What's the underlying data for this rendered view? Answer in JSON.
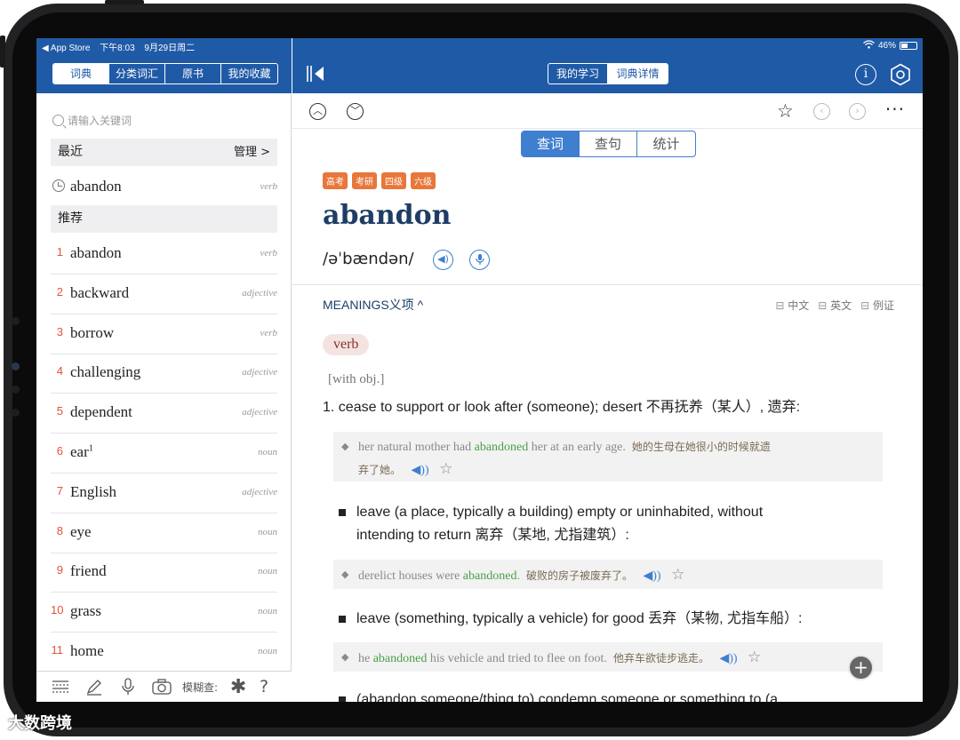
{
  "status_bar": {
    "back_app": "◀ App Store",
    "time": "下午8:03",
    "date": "9月29日周二",
    "battery": "46%",
    "battery_level": 0.46
  },
  "left": {
    "tabs": [
      "词典",
      "分类词汇",
      "原书",
      "我的收藏"
    ],
    "active_tab": 0,
    "search_placeholder": "请输入关键词",
    "recent_label": "最近",
    "manage_label": "管理 >",
    "recent_items": [
      {
        "word": "abandon",
        "pos": "verb"
      }
    ],
    "recommend_label": "推荐",
    "recommend_items": [
      {
        "num": "1",
        "word": "abandon",
        "sup": "",
        "pos": "verb"
      },
      {
        "num": "2",
        "word": "backward",
        "sup": "",
        "pos": "adjective"
      },
      {
        "num": "3",
        "word": "borrow",
        "sup": "",
        "pos": "verb"
      },
      {
        "num": "4",
        "word": "challenging",
        "sup": "",
        "pos": "adjective"
      },
      {
        "num": "5",
        "word": "dependent",
        "sup": "",
        "pos": "adjective"
      },
      {
        "num": "6",
        "word": "ear",
        "sup": "1",
        "pos": "noun"
      },
      {
        "num": "7",
        "word": "English",
        "sup": "",
        "pos": "adjective"
      },
      {
        "num": "8",
        "word": "eye",
        "sup": "",
        "pos": "noun"
      },
      {
        "num": "9",
        "word": "friend",
        "sup": "",
        "pos": "noun"
      },
      {
        "num": "10",
        "word": "grass",
        "sup": "",
        "pos": "noun"
      },
      {
        "num": "11",
        "word": "home",
        "sup": "",
        "pos": "noun"
      }
    ],
    "toolbar": {
      "fuzzy_label": "模糊查:",
      "question": "?"
    }
  },
  "right": {
    "top_tabs": [
      "我的学习",
      "词典详情"
    ],
    "active_top_tab": 1,
    "info_icon_text": "i",
    "sub_tabs": [
      "查词",
      "查句",
      "统计"
    ],
    "active_sub_tab": 0,
    "tags": [
      "高考",
      "考研",
      "四级",
      "六级"
    ],
    "headword": "abandon",
    "phonetic": "/əˈbændən/",
    "meanings_label": "MEANINGS义项 ^",
    "lang_toggles": [
      "中文",
      "英文",
      "例证"
    ],
    "pos": "verb",
    "grammar": "[with obj.]",
    "senses": [
      {
        "label": "1.",
        "text": "cease to support or look after (someone); desert 不再抚养（某人）, 遗弃:"
      },
      {
        "label": "",
        "text": "leave (a place, typically a building) empty or uninhabited, without"
      },
      {
        "label": "",
        "text": "intending to return 离弃（某地, 尤指建筑）:"
      },
      {
        "label": "",
        "text": "leave (something, typically a vehicle) for good 丢弃（某物, 尤指车船）:"
      },
      {
        "label": "",
        "text": "(abandon someone/thing to) condemn someone or something to (a"
      }
    ],
    "examples": [
      {
        "pre": "her natural mother had ",
        "hl": "abandoned",
        "post": " her at an early age.",
        "zh1": "她的生母在她很小的时候就遗",
        "zh2": "弃了她。"
      },
      {
        "pre": "derelict houses were ",
        "hl": "abandoned",
        "post": ".",
        "zh1": "破败的房子被废弃了。",
        "zh2": ""
      },
      {
        "pre": "he ",
        "hl": "abandoned",
        "post": " his vehicle and tried to flee on foot.",
        "zh1": "他弃车欲徒步逃走。",
        "zh2": ""
      }
    ],
    "last_sense_hl": "abandon someone/thing to"
  },
  "watermark": "大数跨境",
  "colors": {
    "header_blue": "#1f5aa6",
    "accent_blue": "#3f7fd0",
    "tag_orange": "#e8773a",
    "number_red": "#e0533a",
    "highlight_green": "#4aa046"
  }
}
